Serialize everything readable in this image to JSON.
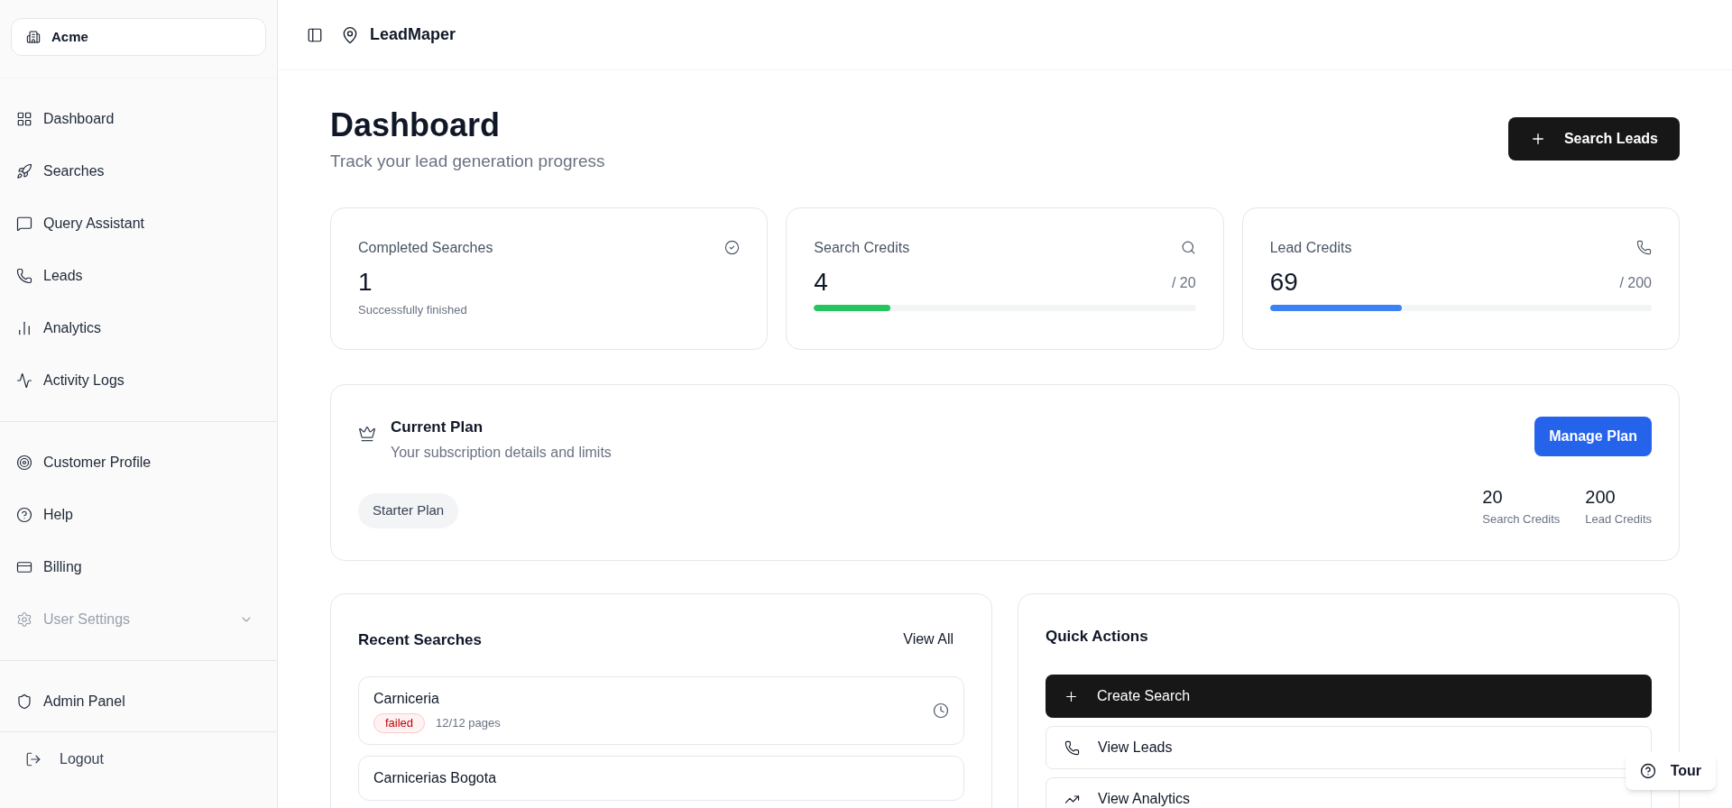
{
  "sidebar": {
    "workspace": "Acme",
    "nav_groups": [
      [
        {
          "label": "Dashboard",
          "kind": "dashboard"
        },
        {
          "label": "Searches",
          "kind": "rocket"
        },
        {
          "label": "Query Assistant",
          "kind": "chat"
        },
        {
          "label": "Leads",
          "kind": "phone"
        },
        {
          "label": "Analytics",
          "kind": "chart"
        },
        {
          "label": "Activity Logs",
          "kind": "activity"
        }
      ],
      [
        {
          "label": "Customer Profile",
          "kind": "target"
        },
        {
          "label": "Help",
          "kind": "help"
        },
        {
          "label": "Billing",
          "kind": "card"
        },
        {
          "label": "User Settings",
          "kind": "gear",
          "muted": true,
          "expanded": false
        }
      ],
      [
        {
          "label": "Admin Panel",
          "kind": "shield"
        }
      ]
    ],
    "logout": "Logout"
  },
  "header": {
    "app_name": "LeadMaper"
  },
  "page": {
    "title": "Dashboard",
    "subtitle": "Track your lead generation progress",
    "action": "Search Leads"
  },
  "stats": [
    {
      "kind": "caption",
      "title": "Completed Searches",
      "value": "1",
      "caption": "Successfully finished"
    },
    {
      "kind": "meter",
      "title": "Search Credits",
      "value": "4",
      "total": "/ 20",
      "level": 0.2,
      "color": "#22c55e"
    },
    {
      "kind": "meter",
      "title": "Lead Credits",
      "value": "69",
      "total": "/ 200",
      "level": 0.345,
      "color": "#3b82f6"
    }
  ],
  "plan": {
    "title": "Current Plan",
    "subtitle": "Your subscription details and limits",
    "button": "Manage Plan",
    "badge": "Starter Plan",
    "limits": [
      {
        "value": "20",
        "label": "Search Credits"
      },
      {
        "value": "200",
        "label": "Lead Credits"
      }
    ]
  },
  "recent_searches": {
    "title": "Recent Searches",
    "link": "View All",
    "items": [
      {
        "name": "Carniceria",
        "status": "failed",
        "pages": "12/12 pages"
      },
      {
        "name": "Carnicerias Bogota"
      }
    ]
  },
  "quick_actions": {
    "title": "Quick Actions",
    "items": [
      {
        "label": "Create Search",
        "kind": "plus",
        "primary": true
      },
      {
        "label": "View Leads",
        "kind": "phone",
        "primary": false
      },
      {
        "label": "View Analytics",
        "kind": "trend",
        "primary": false
      }
    ]
  },
  "tour_button": "Tour"
}
